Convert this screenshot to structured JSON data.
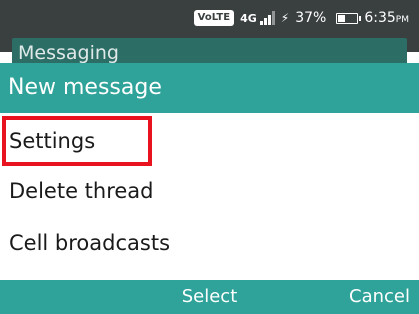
{
  "status_bar": {
    "volte_label": "VoLTE",
    "network_label": "4G",
    "battery_percent_text": "37%",
    "battery_level": 0.37,
    "charging_icon": "charging-bolt-icon",
    "time": "6:35",
    "ampm": "PM"
  },
  "background_app": {
    "title": "Messaging"
  },
  "menu": {
    "title": "New message",
    "items": [
      {
        "label": "Settings",
        "highlighted": true
      },
      {
        "label": "Delete thread"
      },
      {
        "label": "Cell broadcasts"
      }
    ]
  },
  "softkeys": {
    "center": "Select",
    "right": "Cancel"
  },
  "colors": {
    "accent": "#2fa39a",
    "status_bar_bg": "#3a3f3f",
    "highlight_border": "#e8131f"
  }
}
